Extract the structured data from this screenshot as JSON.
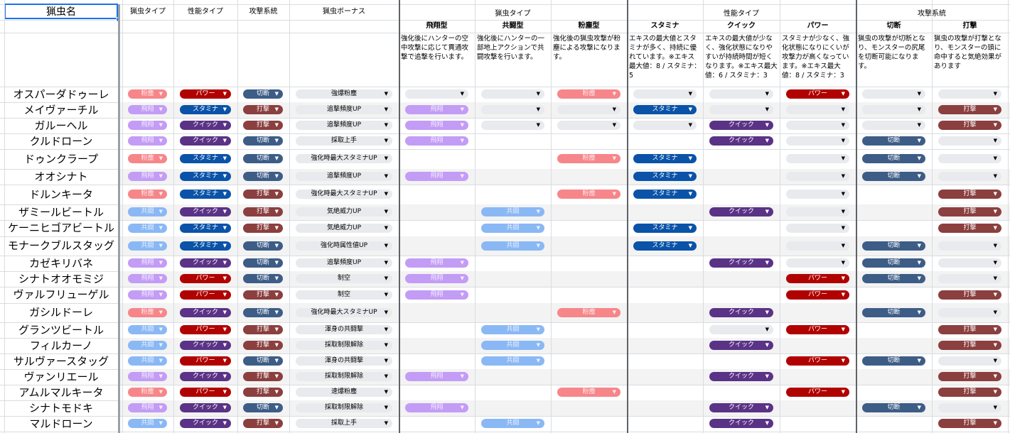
{
  "headers": {
    "name": "猟虫名",
    "type": "猟虫タイプ",
    "perf": "性能タイプ",
    "attack": "攻撃系統",
    "bonus": "猟虫ボーナス",
    "group_type": "猟虫タイプ",
    "group_perf": "性能タイプ",
    "group_attack": "攻撃系統",
    "sub": [
      "飛翔型",
      "共闘型",
      "粉塵型",
      "スタミナ",
      "クイック",
      "パワー",
      "切断",
      "打撃"
    ],
    "desc": [
      "強化後にハンターの空中攻撃に応じて貫通攻撃で追撃を行います。",
      "強化後にハンターの一部地上アクションで共闘攻撃を行います。",
      "強化後の猟虫攻撃が粉塵による攻撃になります。",
      "エキスの最大値とスタミナが多く、持続に優れています。※エキス最大値：8 / スタミナ：5",
      "エキスの最大値が少なく、強化状態になりやすいが持続時間が短くなります。※エキス最大値：6 / スタミナ：3",
      "スタミナが少なく、強化状態になりにくいが攻撃力が高くなっています。※エキス最大値：8 / スタミナ：3",
      "猟虫の攻撃が切断となり、モンスターの尻尾を切断可能になります。",
      "猟虫の攻撃が打撃となり、モンスターの頭に命中すると気絶効果があります"
    ]
  },
  "labels": {
    "funjin": "粉塵",
    "hisho": "飛翔",
    "kyoto": "共闘",
    "power": "パワー",
    "stamina": "スタミナ",
    "quick": "クイック",
    "setsu": "切断",
    "daga": "打撃"
  },
  "colors": {
    "funjin": "#f6868a",
    "hisho": "#c39cf5",
    "kyoto": "#8ab8f5",
    "power": "#b10202",
    "stamina": "#0a53a8",
    "quick": "#5a3286",
    "setsu": "#3d5d87",
    "daga": "#8b3f3f"
  },
  "rows": [
    {
      "name": "オスパーダドゥーレ",
      "type": "funjin",
      "perf": "power",
      "attack": "setsu",
      "bonus": "強爆粉塵",
      "m": [
        "e",
        "e",
        "f",
        "e",
        "e",
        "p",
        "e",
        "e"
      ]
    },
    {
      "name": "メイヴァーチル",
      "type": "hisho",
      "perf": "stamina",
      "attack": "daga",
      "bonus": "追撃頻度UP",
      "m": [
        "h",
        "e",
        "e",
        "s",
        "e",
        "e",
        "e",
        "d"
      ]
    },
    {
      "name": "ガルーヘル",
      "type": "hisho",
      "perf": "quick",
      "attack": "daga",
      "bonus": "追撃頻度UP",
      "m": [
        "h",
        "e",
        "e",
        "e",
        "q",
        "e",
        "e",
        "d"
      ]
    },
    {
      "name": "クルドローン",
      "type": "hisho",
      "perf": "quick",
      "attack": "setsu",
      "bonus": "採取上手",
      "m": [
        "h",
        "",
        "",
        "",
        "q",
        "e",
        "c",
        "e"
      ]
    },
    {
      "name": "ドゥンクラープ",
      "type": "funjin",
      "perf": "stamina",
      "attack": "setsu",
      "bonus": "強化時最大スタミナUP",
      "m": [
        "",
        "",
        "f",
        "s",
        "",
        "e",
        "c",
        "e"
      ]
    },
    {
      "name": "オオシナト",
      "type": "hisho",
      "perf": "stamina",
      "attack": "setsu",
      "bonus": "追撃頻度UP",
      "m": [
        "h",
        "",
        "",
        "s",
        "",
        "e",
        "c",
        "e"
      ]
    },
    {
      "name": "ドルンキータ",
      "type": "funjin",
      "perf": "stamina",
      "attack": "daga",
      "bonus": "強化時最大スタミナUP",
      "m": [
        "",
        "",
        "f",
        "s",
        "",
        "e",
        "",
        "d"
      ]
    },
    {
      "name": "ザミールビートル",
      "type": "kyoto",
      "perf": "quick",
      "attack": "daga",
      "bonus": "気絶威力UP",
      "m": [
        "",
        "k",
        "",
        "",
        "q",
        "e",
        "",
        "d"
      ]
    },
    {
      "name": "ケーニヒゴアビートル",
      "type": "kyoto",
      "perf": "stamina",
      "attack": "daga",
      "bonus": "気絶威力UP",
      "m": [
        "",
        "k",
        "",
        "s",
        "",
        "e",
        "",
        "d"
      ]
    },
    {
      "name": "モナークブルスタッグ",
      "type": "kyoto",
      "perf": "stamina",
      "attack": "setsu",
      "bonus": "強化時属性値UP",
      "m": [
        "",
        "k",
        "",
        "s",
        "",
        "e",
        "c",
        "e"
      ]
    },
    {
      "name": "カゼキリバネ",
      "type": "hisho",
      "perf": "quick",
      "attack": "setsu",
      "bonus": "追撃頻度UP",
      "m": [
        "h",
        "",
        "",
        "",
        "q",
        "e",
        "c",
        "e"
      ]
    },
    {
      "name": "シナトオオモミジ",
      "type": "hisho",
      "perf": "power",
      "attack": "setsu",
      "bonus": "制空",
      "m": [
        "h",
        "",
        "",
        "",
        "",
        "p",
        "c",
        "e"
      ]
    },
    {
      "name": "ヴァルフリューゲル",
      "type": "hisho",
      "perf": "power",
      "attack": "daga",
      "bonus": "制空",
      "m": [
        "h",
        "",
        "",
        "",
        "",
        "p",
        "",
        "d"
      ]
    },
    {
      "name": "ガシルドーレ",
      "type": "funjin",
      "perf": "quick",
      "attack": "setsu",
      "bonus": "強化時最大スタミナUP",
      "m": [
        "",
        "",
        "f",
        "",
        "q",
        "",
        "c",
        "e"
      ]
    },
    {
      "name": "グランツビートル",
      "type": "kyoto",
      "perf": "power",
      "attack": "daga",
      "bonus": "渾身の共闘撃",
      "m": [
        "",
        "k",
        "",
        "",
        "e",
        "p",
        "",
        "d"
      ]
    },
    {
      "name": "フィルカーノ",
      "type": "kyoto",
      "perf": "quick",
      "attack": "daga",
      "bonus": "採取制限解除",
      "m": [
        "",
        "k",
        "",
        "",
        "q",
        "",
        "",
        "d"
      ]
    },
    {
      "name": "サルヴァースタッグ",
      "type": "kyoto",
      "perf": "power",
      "attack": "setsu",
      "bonus": "渾身の共闘撃",
      "m": [
        "",
        "k",
        "",
        "",
        "",
        "p",
        "c",
        "e"
      ]
    },
    {
      "name": "ヴァンリエール",
      "type": "hisho",
      "perf": "quick",
      "attack": "daga",
      "bonus": "採取制限解除",
      "m": [
        "h",
        "",
        "",
        "",
        "q",
        "",
        "",
        "d"
      ]
    },
    {
      "name": "アムルマルキータ",
      "type": "funjin",
      "perf": "power",
      "attack": "daga",
      "bonus": "速爆粉塵",
      "m": [
        "",
        "",
        "f",
        "",
        "",
        "p",
        "",
        "d"
      ]
    },
    {
      "name": "シナトモドキ",
      "type": "hisho",
      "perf": "quick",
      "attack": "setsu",
      "bonus": "採取制限解除",
      "m": [
        "h",
        "",
        "",
        "",
        "q",
        "",
        "c",
        "e"
      ]
    },
    {
      "name": "マルドローン",
      "type": "kyoto",
      "perf": "quick",
      "attack": "daga",
      "bonus": "採取上手",
      "m": [
        "",
        "k",
        "",
        "",
        "q",
        "",
        "",
        "d"
      ]
    }
  ]
}
